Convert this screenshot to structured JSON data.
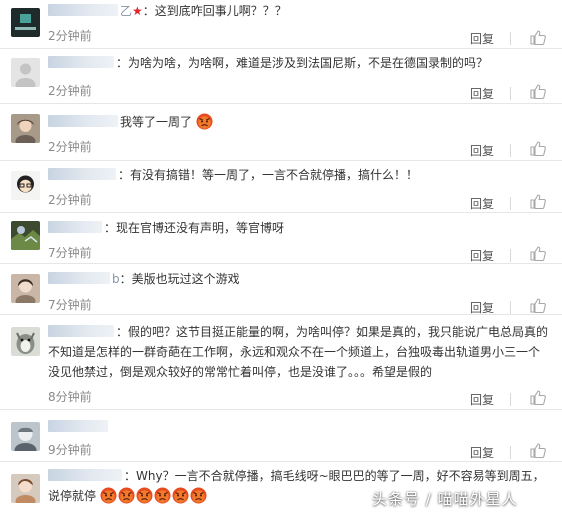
{
  "colors": {
    "username": "#c8d4e2",
    "time": "#8a8a8a",
    "divider": "#e6e6e6",
    "star": "#e2232a"
  },
  "comments": [
    {
      "name_tail": "乙",
      "text": "：这到底咋回事儿啊？？？",
      "time": "2分钟前",
      "reply": "回复"
    },
    {
      "name_tail": "",
      "text": "：为啥为啥，为啥啊，难道是涉及到法国尼斯，不是在德国录制的吗？",
      "time": "2分钟前",
      "reply": "回复"
    },
    {
      "name_tail": "",
      "text": "我等了一周了",
      "time": "2分钟前",
      "reply": "回复"
    },
    {
      "name_tail": "",
      "text": "：有没有搞错！等一周了，一言不合就停播，搞什么！！",
      "time": "2分钟前",
      "reply": "回复"
    },
    {
      "name_tail": "",
      "text": "：现在官博还没有声明，等官博呀",
      "time": "7分钟前",
      "reply": "回复"
    },
    {
      "name_tail": "b",
      "text": "：美版也玩过这个游戏",
      "time": "7分钟前",
      "reply": "回复"
    },
    {
      "name_tail": "",
      "text": "：假的吧？这节目挺正能量的啊，为啥叫停？如果是真的，我只能说广电总局真的不知道是怎样的一群奇葩在工作啊，永远和观众不在一个频道上，台独吸毒出轨道男小三一个没见他禁过，倒是观众较好的常常忙着叫停，也是没谁了。。。希望是假的",
      "time": "8分钟前",
      "reply": "回复"
    },
    {
      "name_tail": "",
      "text": "",
      "time": "9分钟前",
      "reply": "回复"
    },
    {
      "name_tail": "",
      "text": "：Why？一言不合就停播，搞毛线呀~眼巴巴的等了一周，好不容易等到周五，说停就停",
      "time": "",
      "reply": ""
    }
  ],
  "icons": {
    "like": "thumbs-up-icon",
    "angry": "angry-face-emoji",
    "star": "star-icon"
  },
  "watermark": "头条号 / 喵喵外星人"
}
